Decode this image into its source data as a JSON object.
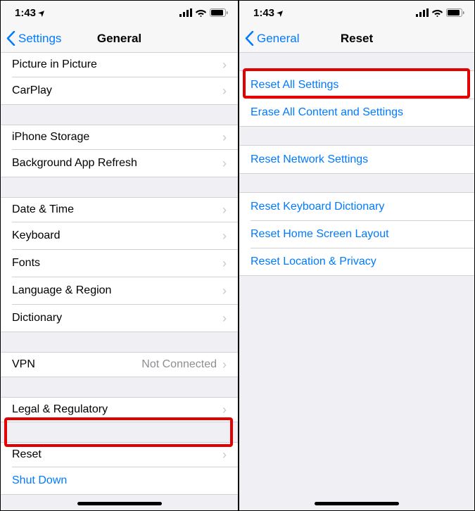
{
  "status": {
    "time": "1:43",
    "location_icon": "➤"
  },
  "left": {
    "back_label": "Settings",
    "title": "General",
    "rows": {
      "pip": "Picture in Picture",
      "carplay": "CarPlay",
      "storage": "iPhone Storage",
      "bgrefresh": "Background App Refresh",
      "datetime": "Date & Time",
      "keyboard": "Keyboard",
      "fonts": "Fonts",
      "langregion": "Language & Region",
      "dictionary": "Dictionary",
      "vpn_label": "VPN",
      "vpn_value": "Not Connected",
      "legal": "Legal & Regulatory",
      "reset": "Reset",
      "shutdown": "Shut Down"
    }
  },
  "right": {
    "back_label": "General",
    "title": "Reset",
    "rows": {
      "reset_all": "Reset All Settings",
      "erase_all": "Erase All Content and Settings",
      "reset_network": "Reset Network Settings",
      "reset_keyboard": "Reset Keyboard Dictionary",
      "reset_home": "Reset Home Screen Layout",
      "reset_location": "Reset Location & Privacy"
    }
  }
}
